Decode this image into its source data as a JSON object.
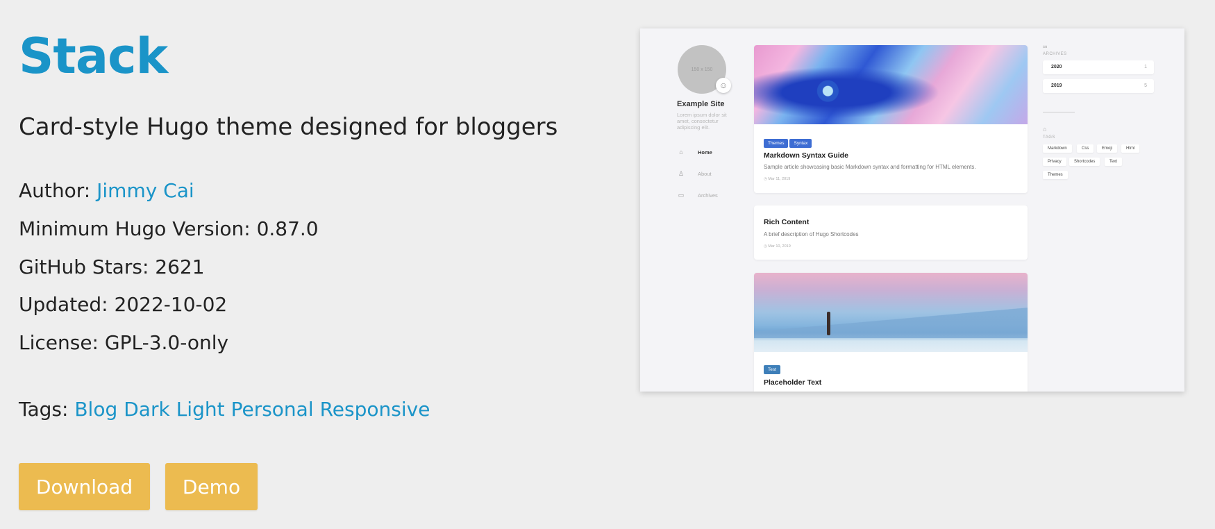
{
  "theme": {
    "name": "Stack",
    "description": "Card-style Hugo theme designed for bloggers",
    "author_label": "Author:",
    "author": "Jimmy Cai",
    "min_version": "Minimum Hugo Version: 0.87.0",
    "stars": "GitHub Stars: 2621",
    "updated": "Updated: 2022-10-02",
    "license": "License: GPL-3.0-only",
    "tags_label": "Tags:",
    "tags": [
      "Blog",
      "Dark",
      "Light",
      "Personal",
      "Responsive"
    ]
  },
  "buttons": {
    "download": "Download",
    "demo": "Demo"
  },
  "colors": {
    "title": "#1a94c8",
    "link": "#1a94c8",
    "button": "#ecbb50",
    "background": "#eeeeee"
  },
  "preview": {
    "avatar_text": "150 x 150",
    "site_name": "Example Site",
    "site_description": "Lorem ipsum dolor sit amet, consectetur adipiscing elit.",
    "nav": [
      {
        "label": "Home",
        "icon": "home-icon"
      },
      {
        "label": "About",
        "icon": "user-icon"
      },
      {
        "label": "Archives",
        "icon": "archive-icon"
      }
    ],
    "posts": [
      {
        "tags": [
          "Themes",
          "Syntax"
        ],
        "title": "Markdown Syntax Guide",
        "description": "Sample article showcasing basic Markdown syntax and formatting for HTML elements.",
        "date": "Mar 11, 2019"
      },
      {
        "title": "Rich Content",
        "description": "A brief description of Hugo Shortcodes",
        "date": "Mar 10, 2019"
      },
      {
        "tags": [
          "Test"
        ],
        "title": "Placeholder Text"
      }
    ],
    "archives_heading": "ARCHIVES",
    "archives": [
      {
        "year": "2020",
        "count": "1"
      },
      {
        "year": "2019",
        "count": "5"
      }
    ],
    "tags_heading": "TAGS",
    "tag_cloud": [
      "Markdown",
      "Css",
      "Emoji",
      "Html",
      "Privacy",
      "Shortcodes",
      "Text",
      "Themes"
    ]
  }
}
